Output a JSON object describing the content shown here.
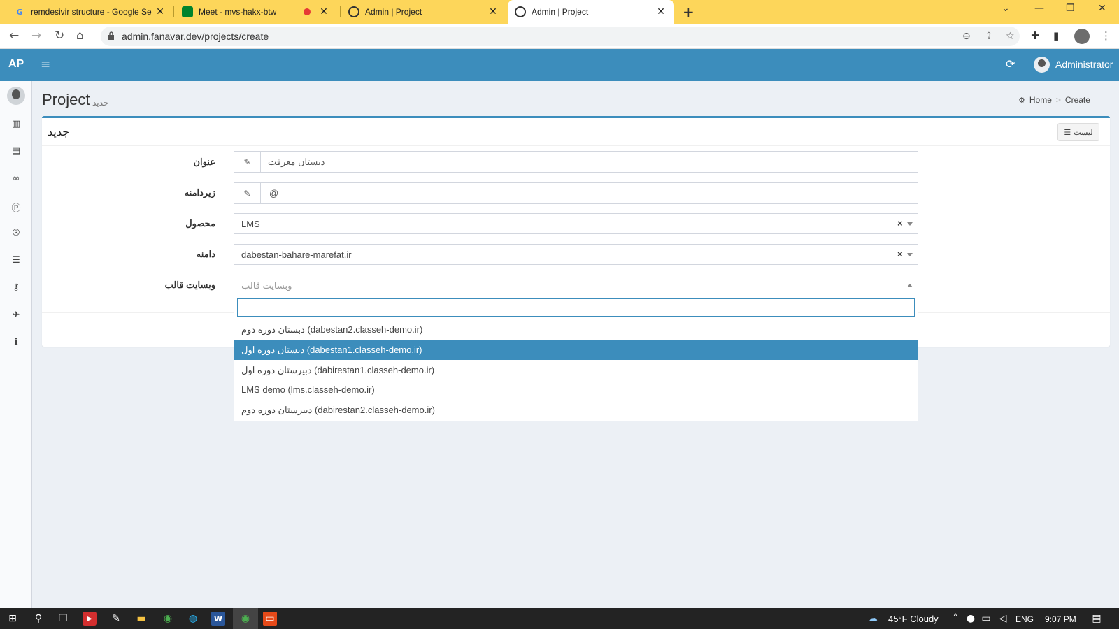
{
  "browser": {
    "tabs": [
      {
        "title": "remdesivir structure - Google Se",
        "favicon": "G",
        "favicon_color": "#4285f4",
        "close": "✕"
      },
      {
        "title": "Meet - mvs-hakx-btw",
        "favicon": "meet-icon",
        "favicon_color": "#00832d",
        "close": "✕"
      },
      {
        "title": "Admin | Project",
        "favicon": "globe-icon",
        "favicon_color": "#333333",
        "close": "✕"
      },
      {
        "title": "Admin | Project",
        "favicon": "globe-icon",
        "favicon_color": "#333333",
        "close": "✕"
      }
    ],
    "url": "admin.fanavar.dev/projects/create"
  },
  "header": {
    "logo": "AP",
    "user": "Administrator",
    "color": "#3c8dbc"
  },
  "page": {
    "title": "Project",
    "subtitle": "جدید",
    "breadcrumb": {
      "home": "Home",
      "current": "Create"
    }
  },
  "box": {
    "title": "جدید",
    "list_button": "لیست"
  },
  "form": {
    "title_label": "عنوان",
    "title_value": "دبستان معرفت",
    "subdomain_label": "زیردامنه",
    "subdomain_value": "@",
    "product_label": "محصول",
    "product_value": "LMS",
    "domain_label": "دامنه",
    "domain_value": "dabestan-bahare-marefat.ir",
    "template_label": "وبسایت قالب",
    "template_placeholder": "وبسایت قالب"
  },
  "dropdown": {
    "options": [
      {
        "label": "دبستان دوره دوم (dabestan2.classeh-demo.ir)",
        "selected": false
      },
      {
        "label": "دبستان دوره اول (dabestan1.classeh-demo.ir)",
        "selected": true
      },
      {
        "label": "دبیرستان دوره اول (dabirestan1.classeh-demo.ir)",
        "selected": false
      },
      {
        "label": "LMS demo (lms.classeh-demo.ir)",
        "selected": false
      },
      {
        "label": "دبیرستان دوره دوم (dabirestan2.classeh-demo.ir)",
        "selected": false
      }
    ]
  },
  "taskbar": {
    "weather": "45°F  Cloudy",
    "lang": "ENG",
    "time": "9:07 PM"
  }
}
